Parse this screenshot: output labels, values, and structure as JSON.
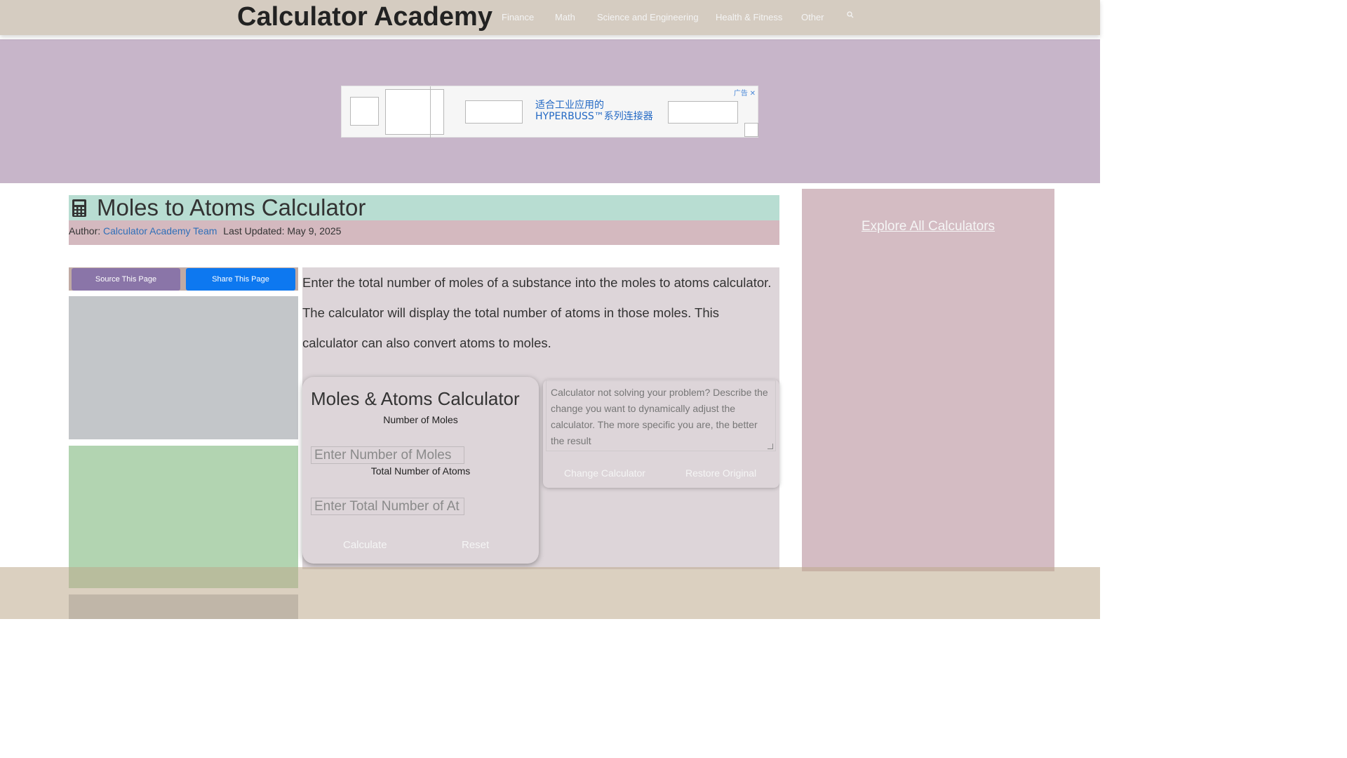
{
  "brand": "Calculator Academy",
  "nav": {
    "items": [
      "Finance",
      "Math",
      "Science and Engineering",
      "Health & Fitness",
      "Other"
    ],
    "search_icon": "search-icon"
  },
  "ad": {
    "text_line1": "适合工业应用的",
    "text_line2": "HYPERBUSS™系列连接器",
    "badge": "广告",
    "close": "✕"
  },
  "page": {
    "title": "Moles to Atoms Calculator",
    "author_label": "Author:",
    "author_name": "Calculator Academy Team",
    "updated": "Last Updated: May 9, 2025"
  },
  "left": {
    "source_button": "Source This Page",
    "share_button": "Share This Page"
  },
  "intro": "Enter the total number of moles of a substance into the moles to atoms calculator. The calculator will display the total number of atoms in those moles. This calculator can also convert atoms to moles.",
  "calculator": {
    "title": "Moles & Atoms Calculator",
    "field1_label": "Number of Moles",
    "field1_placeholder": "Enter Number of Moles",
    "field2_label": "Total Number of Atoms",
    "field2_placeholder": "Enter Total Number of At",
    "calculate": "Calculate",
    "reset": "Reset"
  },
  "adjust": {
    "placeholder": "Calculator not solving your problem? Describe the change you want to dynamically adjust the calculator. The more specific you are, the better the result",
    "change": "Change Calculator",
    "restore": "Restore Original"
  },
  "sidebar": {
    "explore": "Explore All Calculators"
  },
  "colors": {
    "nav_bg": "#d5ccc1",
    "ad_band": "#c7b5c9",
    "title_bar": "#b8ddd2",
    "meta_bar": "#d4b9bf",
    "source_btn": "#8a75a8",
    "share_btn": "#0d78f0",
    "main_bg": "#ddd5d9",
    "sidebar_bg": "#d4bcc3",
    "left_gray": "#c3c6c9",
    "left_green": "#b2d4b1"
  }
}
